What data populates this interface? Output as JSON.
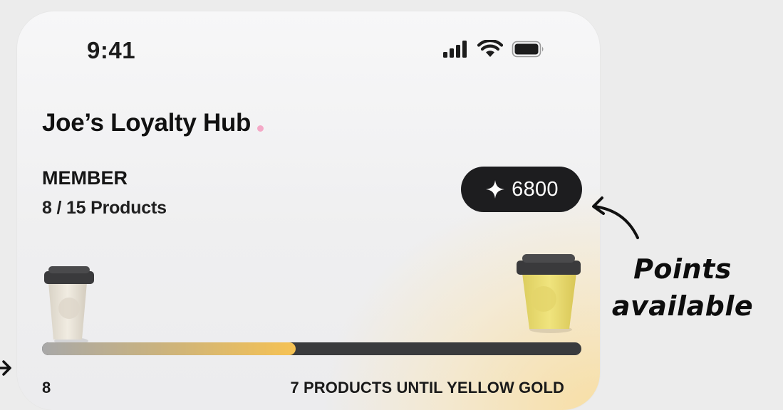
{
  "status_bar": {
    "time": "9:41",
    "icons": [
      "signal-icon",
      "wifi-icon",
      "battery-icon"
    ]
  },
  "header": {
    "title": "Joe’s Loyalty Hub"
  },
  "membership": {
    "tier": "MEMBER",
    "products": "8 / 15 Products"
  },
  "points": {
    "icon": "sparkle-icon",
    "value": "6800"
  },
  "progress": {
    "fraction": 0.47,
    "current_label": "8",
    "until_label": "7 PRODUCTS UNTIL YELLOW GOLD",
    "start_cup_color": "#ebe6dc",
    "goal_cup_color": "#ecde72"
  },
  "annotations": {
    "points_line1": "Points",
    "points_line2": "available"
  },
  "colors": {
    "accent_gold": "#f6c253",
    "pill_dark": "#1d1d1f",
    "title_dot": "#f4a9c7"
  }
}
